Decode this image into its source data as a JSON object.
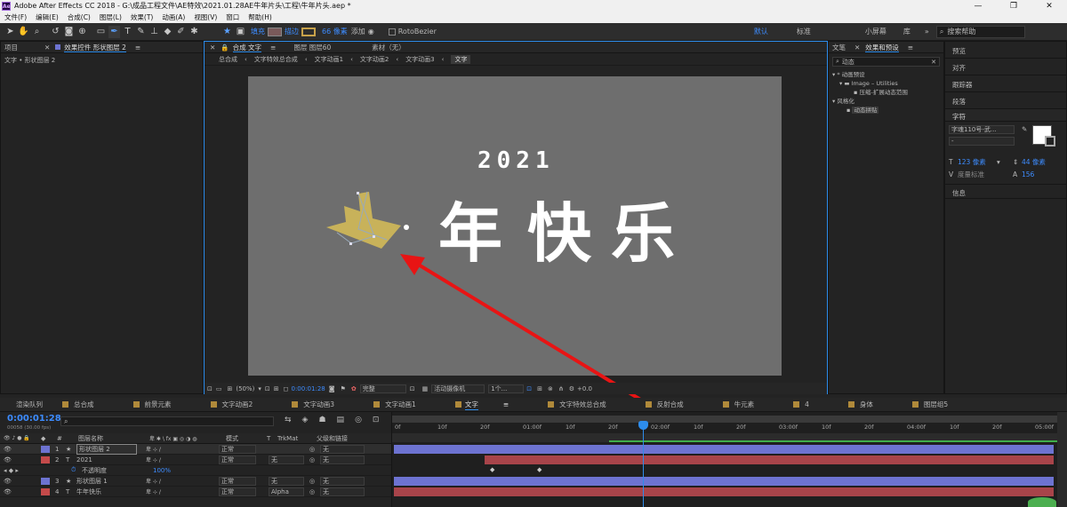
{
  "window": {
    "title": "Adobe After Effects CC 2018 - G:\\成品工程文件\\AE特效\\2021.01.28AE牛年片头\\工程\\牛年片头.aep *",
    "icon": "Ae",
    "minimize": "—",
    "maximize": "❐",
    "close": "✕"
  },
  "menu": [
    "文件(F)",
    "编辑(E)",
    "合成(C)",
    "图层(L)",
    "效果(T)",
    "动画(A)",
    "视图(V)",
    "窗口",
    "帮助(H)"
  ],
  "toolbar": {
    "fill_label": "填充",
    "stroke_label": "描边",
    "stroke_width": "66 像素",
    "add_label": "添加",
    "rotobezier_label": "RotoBezier",
    "workspaces": [
      "默认",
      "标准",
      "小屏幕",
      "库"
    ],
    "search_placeholder": "搜索帮助",
    "fill_color": "#7a5a5a",
    "stroke_color": "#c8a24a"
  },
  "left_panel": {
    "tab_project": "项目",
    "tab_effects": "效果控件 形状图层 2",
    "breadcrumb": "文字 • 形状图层 2"
  },
  "comp_panel": {
    "tabs": [
      "合成 文字",
      "图层 图层60",
      "素材（无）"
    ],
    "breadcrumbs": [
      "总合成",
      "文字特效总合成",
      "文字动画1",
      "文字动画2",
      "文字动画3",
      "文字"
    ],
    "canvas_texts": {
      "year": "2021",
      "chars": [
        "年",
        "快",
        "乐"
      ]
    },
    "footer": {
      "zoom": "(50%)",
      "timecode": "0:00:01:28",
      "quality": "完整",
      "camera": "活动摄像机",
      "views": "1个...",
      "exposure": "+0.0"
    }
  },
  "right_panel": {
    "tabs": [
      "文笔",
      "效果和预设"
    ],
    "search_value": "动态",
    "tree": [
      "* 动画预设",
      "Image – Utilities",
      "压缩-扩展动态范围",
      "风格化",
      "动态拼贴"
    ]
  },
  "far_right": {
    "items": [
      "预览",
      "对齐",
      "跟踪器",
      "段落"
    ],
    "char_header": "字符",
    "font_name": "字魂110号-武...",
    "font_style": "-",
    "font_size": "123 像素",
    "leading": "44 像素",
    "kerning": "度量标准",
    "tracking": "156",
    "info": "信息"
  },
  "timeline": {
    "tabs": [
      "渲染队列",
      "总合成",
      "前景元素",
      "文字动画2",
      "文字动画3",
      "文字动画1",
      "文字",
      "文字特效总合成",
      "反射合成",
      "牛元素",
      "4",
      "身体",
      "图层组5"
    ],
    "active_tab": "文字",
    "timecode": "0:00:01:28",
    "fps": "00058 (30.00 fps)",
    "search_placeholder": "",
    "columns": {
      "layer_name": "图层名称",
      "mode": "模式",
      "t": "T",
      "trkmat": "TrkMat",
      "parent": "父级和链接"
    },
    "ruler": [
      "0f",
      "10f",
      "20f",
      "01:00f",
      "10f",
      "20f",
      "02:00f",
      "10f",
      "20f",
      "03:00f",
      "10f",
      "20f",
      "04:00f",
      "10f",
      "20f",
      "05:00f"
    ],
    "layers": [
      {
        "num": "1",
        "icon": "★",
        "name": "形状图层 2",
        "mode": "正常",
        "trkmat": "",
        "parent": "无",
        "color": "#6d73d1"
      },
      {
        "num": "2",
        "icon": "T",
        "name": "2021",
        "mode": "正常",
        "trkmat": "无",
        "parent": "无",
        "color": "#c44a4a"
      },
      {
        "num": "",
        "icon": "",
        "name": "不透明度",
        "mode": "100%",
        "trkmat": "",
        "parent": "",
        "color": ""
      },
      {
        "num": "3",
        "icon": "★",
        "name": "形状图层 1",
        "mode": "正常",
        "trkmat": "无",
        "parent": "无",
        "color": "#6d73d1"
      },
      {
        "num": "4",
        "icon": "T",
        "name": "牛年快乐",
        "mode": "正常",
        "trkmat": "Alpha",
        "parent": "无",
        "color": "#c44a4a"
      }
    ]
  }
}
